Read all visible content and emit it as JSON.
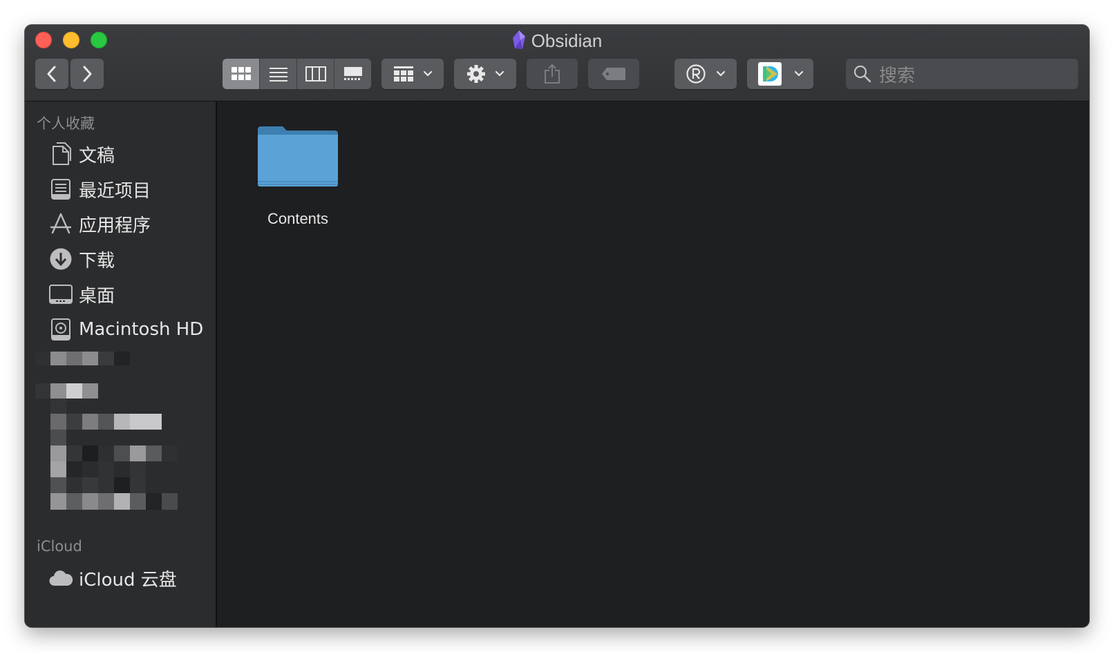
{
  "window": {
    "title": "Obsidian"
  },
  "toolbar": {
    "back_icon": "chevron-left-icon",
    "forward_icon": "chevron-right-icon",
    "views": [
      "icon-view",
      "list-view",
      "column-view",
      "gallery-view"
    ],
    "active_view": "icon-view",
    "group_icon": "group-grid-icon",
    "action_icon": "gear-icon",
    "share_icon": "share-icon",
    "tag_icon": "tag-icon",
    "ext1_icon": "registered-icon",
    "ext2_icon": "app-extension-icon",
    "search_placeholder": "搜索"
  },
  "sidebar": {
    "favorites_title": "个人收藏",
    "favorites": [
      {
        "label": "文稿",
        "icon": "document-icon"
      },
      {
        "label": "最近项目",
        "icon": "recents-icon"
      },
      {
        "label": "应用程序",
        "icon": "applications-icon"
      },
      {
        "label": "下载",
        "icon": "downloads-icon"
      },
      {
        "label": "桌面",
        "icon": "desktop-icon"
      },
      {
        "label": "Macintosh HD",
        "icon": "harddisk-icon"
      }
    ],
    "icloud_title": "iCloud",
    "icloud_items": [
      {
        "label": "iCloud 云盘",
        "icon": "cloud-icon"
      }
    ]
  },
  "content": {
    "items": [
      {
        "name": "Contents",
        "icon": "folder-icon"
      }
    ]
  },
  "colors": {
    "window_bg": "#1e1f21",
    "sidebar_bg": "#2b2c2e",
    "toolbar_button": "#5a5b5e",
    "folder_blue": "#5ba3d6"
  }
}
